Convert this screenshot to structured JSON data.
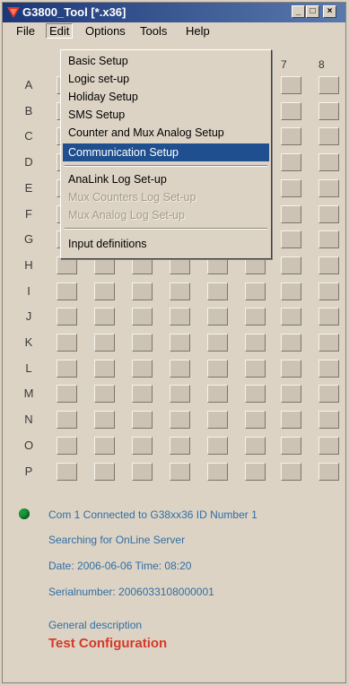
{
  "window": {
    "title": "G3800_Tool [*.x36]",
    "buttons": {
      "minimize": "_",
      "maximize": "□",
      "close": "×"
    }
  },
  "menubar": {
    "file": "File",
    "edit": "Edit",
    "options": "Options",
    "tools": "Tools",
    "help": "Help"
  },
  "grid": {
    "columns": [
      "7",
      "8"
    ],
    "rows": [
      "A",
      "B",
      "C",
      "D",
      "E",
      "F",
      "G",
      "H",
      "I",
      "J",
      "K",
      "L",
      "M",
      "N",
      "O",
      "P"
    ]
  },
  "edit_menu": {
    "items": [
      {
        "label": "Basic Setup",
        "state": "enabled"
      },
      {
        "label": "Logic set-up",
        "state": "enabled"
      },
      {
        "label": "Holiday Setup",
        "state": "enabled"
      },
      {
        "label": "SMS Setup",
        "state": "enabled"
      },
      {
        "label": "Counter and Mux Analog Setup",
        "state": "enabled"
      },
      {
        "label": "Communication Setup",
        "state": "selected"
      },
      {
        "label": "AnaLink Log Set-up",
        "state": "enabled"
      },
      {
        "label": "Mux Counters Log Set-up",
        "state": "disabled"
      },
      {
        "label": "Mux Analog Log Set-up",
        "state": "disabled"
      },
      {
        "label": "Input definitions",
        "state": "enabled"
      }
    ]
  },
  "status": {
    "connection": "Com 1 Connected to  G38xx36 ID Number 1",
    "server": "Searching for OnLine Server",
    "datetime": "Date: 2006-06-06  Time: 08:20",
    "serial": "Serialnumber: 2006033108000001",
    "description_label": "General description",
    "description_value": "Test Configuration",
    "led_color": "#1a9a3a"
  },
  "colors": {
    "titlebar": "#1c3778",
    "selection": "#1f4f8f",
    "status_text": "#2f6ea6",
    "config_text": "#d33a2a"
  }
}
